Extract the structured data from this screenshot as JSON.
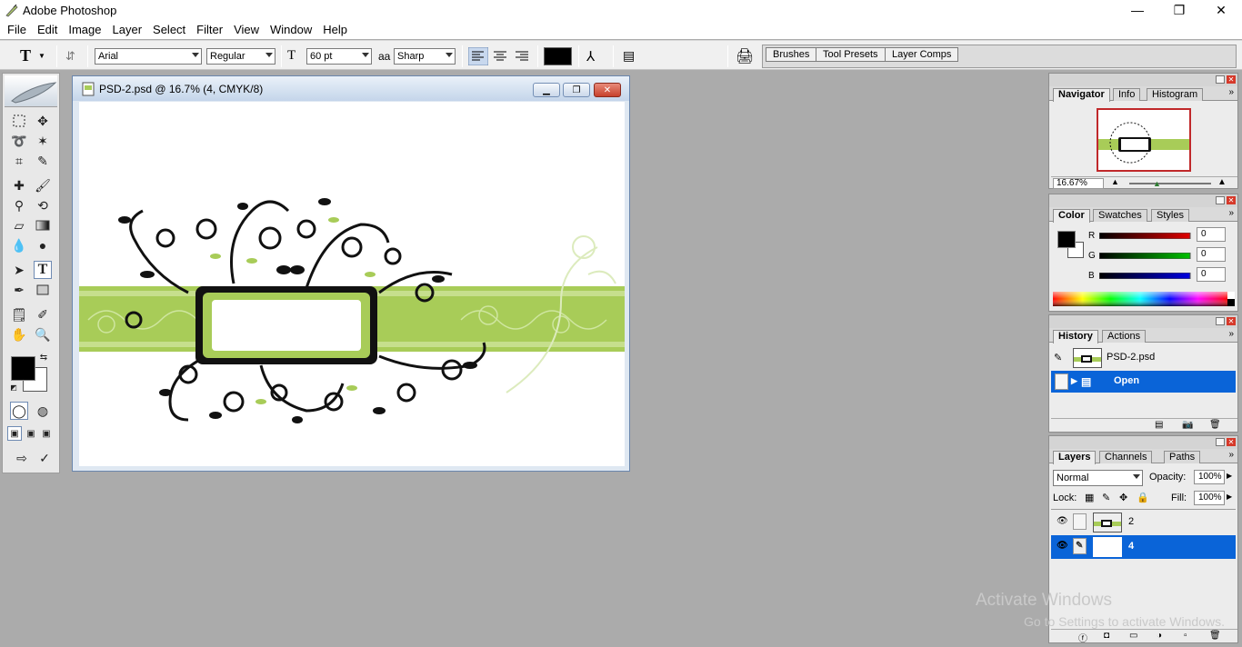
{
  "window": {
    "title": "Adobe Photoshop",
    "controls": {
      "minimize": "—",
      "restore": "❐",
      "close": "✕"
    }
  },
  "menu": [
    "File",
    "Edit",
    "Image",
    "Layer",
    "Select",
    "Filter",
    "View",
    "Window",
    "Help"
  ],
  "options_bar": {
    "tool_glyph": "T",
    "font_family": "Arial",
    "font_style": "Regular",
    "font_size": "60 pt",
    "antialias_label": "aa",
    "antialias": "Sharp",
    "text_color": "#000000",
    "palette_well": [
      "Brushes",
      "Tool Presets",
      "Layer Comps"
    ]
  },
  "document": {
    "title": "PSD-2.psd @ 16.7% (4, CMYK/8)"
  },
  "colors": {
    "accent_green": "#a8cc58",
    "light_green": "#d6e9ad",
    "selection_blue": "#0a64d8",
    "close_red": "#d6392a"
  },
  "navigator": {
    "tabs": [
      "Navigator",
      "Info",
      "Histogram"
    ],
    "zoom": "16.67%"
  },
  "color_panel": {
    "tabs": [
      "Color",
      "Swatches",
      "Styles"
    ],
    "channels": [
      {
        "label": "R",
        "value": "0",
        "color": "#e00000"
      },
      {
        "label": "G",
        "value": "0",
        "color": "#00c000"
      },
      {
        "label": "B",
        "value": "0",
        "color": "#0000e0"
      }
    ]
  },
  "history": {
    "tabs": [
      "History",
      "Actions"
    ],
    "snapshot": "PSD-2.psd",
    "items": [
      "Open"
    ]
  },
  "layers": {
    "tabs": [
      "Layers",
      "Channels",
      "Paths"
    ],
    "blend_mode": "Normal",
    "opacity_label": "Opacity:",
    "opacity": "100%",
    "lock_label": "Lock:",
    "fill_label": "Fill:",
    "fill": "100%",
    "items": [
      {
        "name": "2",
        "selected": false
      },
      {
        "name": "4",
        "selected": true
      }
    ]
  },
  "watermark": {
    "line1": "Activate Windows",
    "line2": "Go to Settings to activate Windows."
  }
}
